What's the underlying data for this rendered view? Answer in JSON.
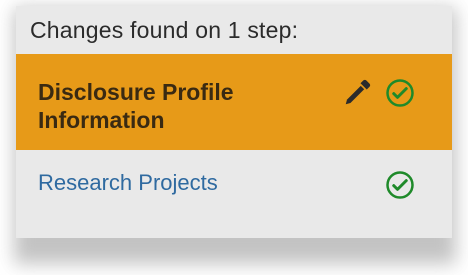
{
  "header": {
    "text": "Changes found on 1 step:"
  },
  "steps": [
    {
      "label": "Disclosure Profile Information",
      "state": "active",
      "icons": [
        "pencil-icon",
        "check-circle-icon"
      ],
      "colors": {
        "background": "#e79a18",
        "text": "#3a2a12",
        "check": "#1f8a2a"
      }
    },
    {
      "label": "Research Projects",
      "state": "default",
      "icons": [
        "check-circle-icon"
      ],
      "colors": {
        "background": "#e9e9e9",
        "text": "#2f6aa0",
        "check": "#1f8a2a"
      }
    }
  ],
  "theme": {
    "panel_background": "#e9e9e9"
  }
}
